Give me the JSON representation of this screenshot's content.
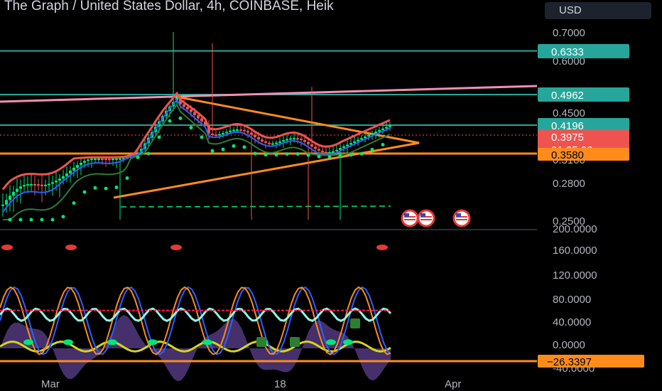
{
  "header": {
    "title": "The Graph / United States Dollar, 4h, COINBASE, Heik",
    "currency": "USD"
  },
  "colors": {
    "background": "#000000",
    "teal": "#26a69a",
    "pink": "#f48fb1",
    "orange": "#ff8c1a",
    "red": "#ef5350",
    "green": "#00e676",
    "cyan": "#8ff7e8",
    "blue": "#2962ff",
    "yellow": "#d4d41c",
    "purple": "#7e57c2"
  },
  "chart_data": [
    {
      "type": "candlestick",
      "title": "The Graph / United States Dollar, 4h, COINBASE, Heik",
      "price_ticks": [
        "0.7000",
        "0.6000",
        "0.4500",
        "0.3100",
        "0.2800",
        "0.2500"
      ],
      "price_tags": [
        {
          "label": "0.6333",
          "color": "#26a69a",
          "text": "#ffffff"
        },
        {
          "label": "0.4962",
          "color": "#26a69a",
          "text": "#ffffff"
        },
        {
          "label": "0.4196",
          "color": "#26a69a",
          "text": "#ffffff"
        },
        {
          "label": "0.3975",
          "color": "#ef5350",
          "text": "#ffffff"
        },
        {
          "label": "01:25:06",
          "color": "#ef5350",
          "text": "#ffffff"
        },
        {
          "label": "0.3580",
          "color": "#ff8c1a",
          "text": "#000000"
        }
      ],
      "horizontal_levels": [
        0.6333,
        0.4962,
        0.4196,
        0.358
      ],
      "last_price": 0.3975
    },
    {
      "type": "line",
      "title": "",
      "y_ticks": [
        "200.0000",
        "160.0000",
        "120.0000",
        "80.0000",
        "40.0000",
        "0.0000",
        "-40.0000"
      ],
      "value_tag": {
        "label": "−26.3397",
        "color": "#ff8c1a",
        "text": "#000000"
      },
      "ylim": [
        -40,
        200
      ]
    }
  ],
  "x_axis": {
    "ticks": [
      "Mar",
      "18",
      "Apr"
    ]
  }
}
